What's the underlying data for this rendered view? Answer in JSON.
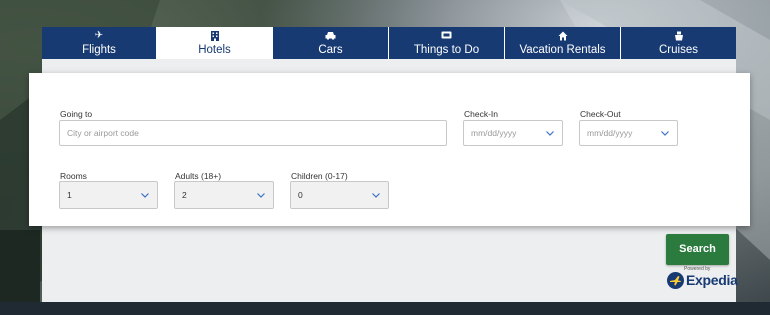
{
  "tabs": [
    {
      "label": "Flights",
      "icon": "plane-icon"
    },
    {
      "label": "Hotels",
      "icon": "building-icon"
    },
    {
      "label": "Cars",
      "icon": "car-icon"
    },
    {
      "label": "Things to Do",
      "icon": "ticket-icon"
    },
    {
      "label": "Vacation Rentals",
      "icon": "house-icon"
    },
    {
      "label": "Cruises",
      "icon": "ship-icon"
    }
  ],
  "active_tab": "Hotels",
  "form": {
    "going_to": {
      "label": "Going to",
      "placeholder": "City or airport code"
    },
    "check_in": {
      "label": "Check-In",
      "placeholder": "mm/dd/yyyy"
    },
    "check_out": {
      "label": "Check-Out",
      "placeholder": "mm/dd/yyyy"
    },
    "rooms": {
      "label": "Rooms",
      "value": "1"
    },
    "adults": {
      "label": "Adults (18+)",
      "value": "2"
    },
    "children": {
      "label": "Children (0-17)",
      "value": "0"
    }
  },
  "search_button": "Search",
  "powered_by": "Powered by",
  "brand": "Expedia",
  "colors": {
    "tab_blue": "#183a73",
    "search_green": "#2b7a3e",
    "chevron_blue": "#3a72c4"
  }
}
